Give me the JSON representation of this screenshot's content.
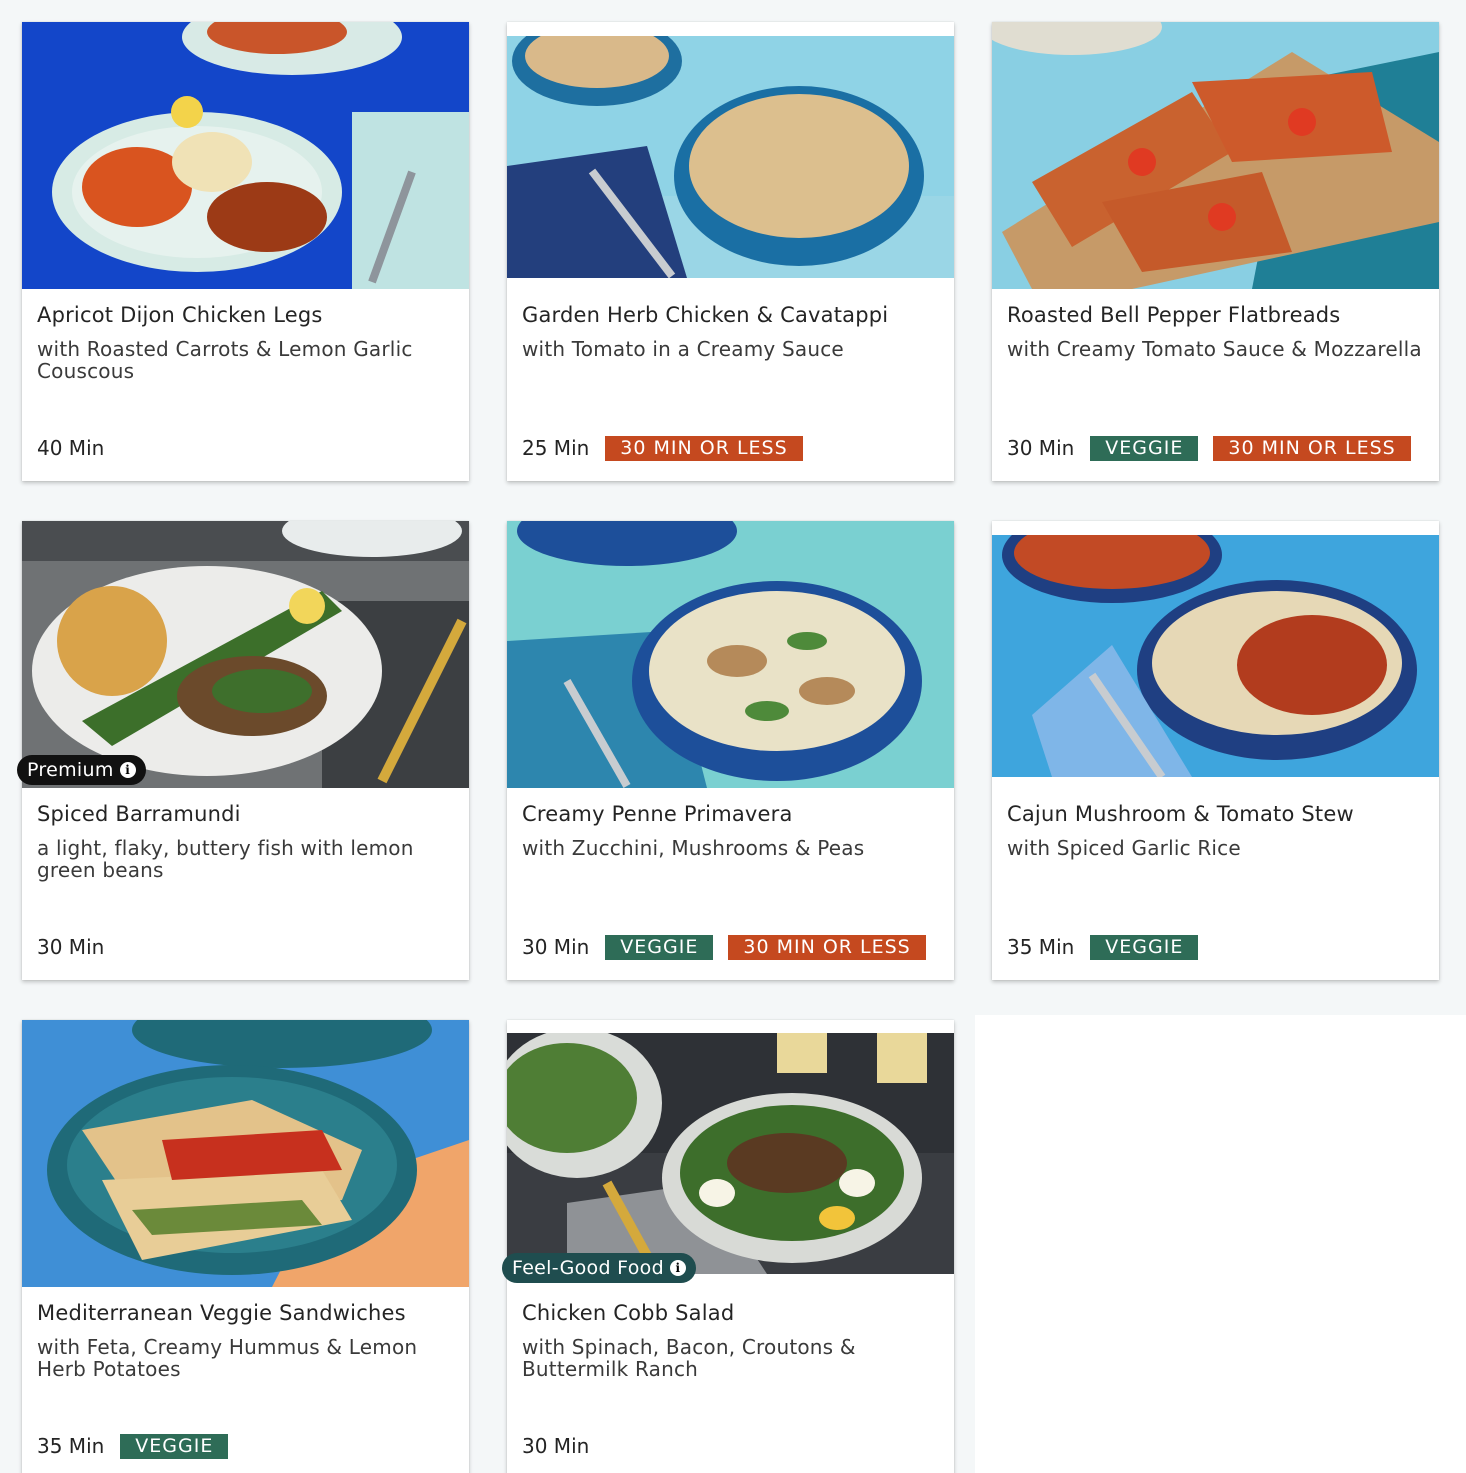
{
  "colors": {
    "veggie": "#2e6c57",
    "quick": "#c5491f",
    "premium": "#111111",
    "feel_good": "#1f4d4f"
  },
  "recipes": [
    {
      "title": "Apricot Dijon Chicken Legs",
      "subtitle": "with Roasted Carrots & Lemon Garlic Couscous",
      "time": "40 Min",
      "tags": []
    },
    {
      "title": "Garden Herb Chicken & Cavatappi",
      "subtitle": "with Tomato in a Creamy Sauce",
      "time": "25 Min",
      "tags": [
        {
          "label": "30 MIN OR LESS",
          "color": "#c5491f"
        }
      ]
    },
    {
      "title": "Roasted Bell Pepper Flatbreads",
      "subtitle": "with Creamy Tomato Sauce & Mozzarella",
      "time": "30 Min",
      "tags": [
        {
          "label": "VEGGIE",
          "color": "#2e6c57"
        },
        {
          "label": "30 MIN OR LESS",
          "color": "#c5491f"
        }
      ]
    },
    {
      "title": "Spiced Barramundi",
      "subtitle": "a light, flaky, buttery fish with lemon green beans",
      "time": "30 Min",
      "badge": "Premium",
      "tags": []
    },
    {
      "title": "Creamy Penne Primavera",
      "subtitle": "with Zucchini, Mushrooms & Peas",
      "time": "30 Min",
      "tags": [
        {
          "label": "VEGGIE",
          "color": "#2e6c57"
        },
        {
          "label": "30 MIN OR LESS",
          "color": "#c5491f"
        }
      ]
    },
    {
      "title": "Cajun Mushroom & Tomato Stew",
      "subtitle": "with Spiced Garlic Rice",
      "time": "35 Min",
      "tags": [
        {
          "label": "VEGGIE",
          "color": "#2e6c57"
        }
      ]
    },
    {
      "title": "Mediterranean Veggie Sandwiches",
      "subtitle": "with Feta, Creamy Hummus & Lemon Herb Potatoes",
      "time": "35 Min",
      "tags": [
        {
          "label": "VEGGIE",
          "color": "#2e6c57"
        }
      ]
    },
    {
      "title": "Chicken Cobb Salad",
      "subtitle": "with Spinach, Bacon, Croutons & Buttermilk Ranch",
      "time": "30 Min",
      "badge": "Feel-Good Food",
      "tags": []
    }
  ]
}
